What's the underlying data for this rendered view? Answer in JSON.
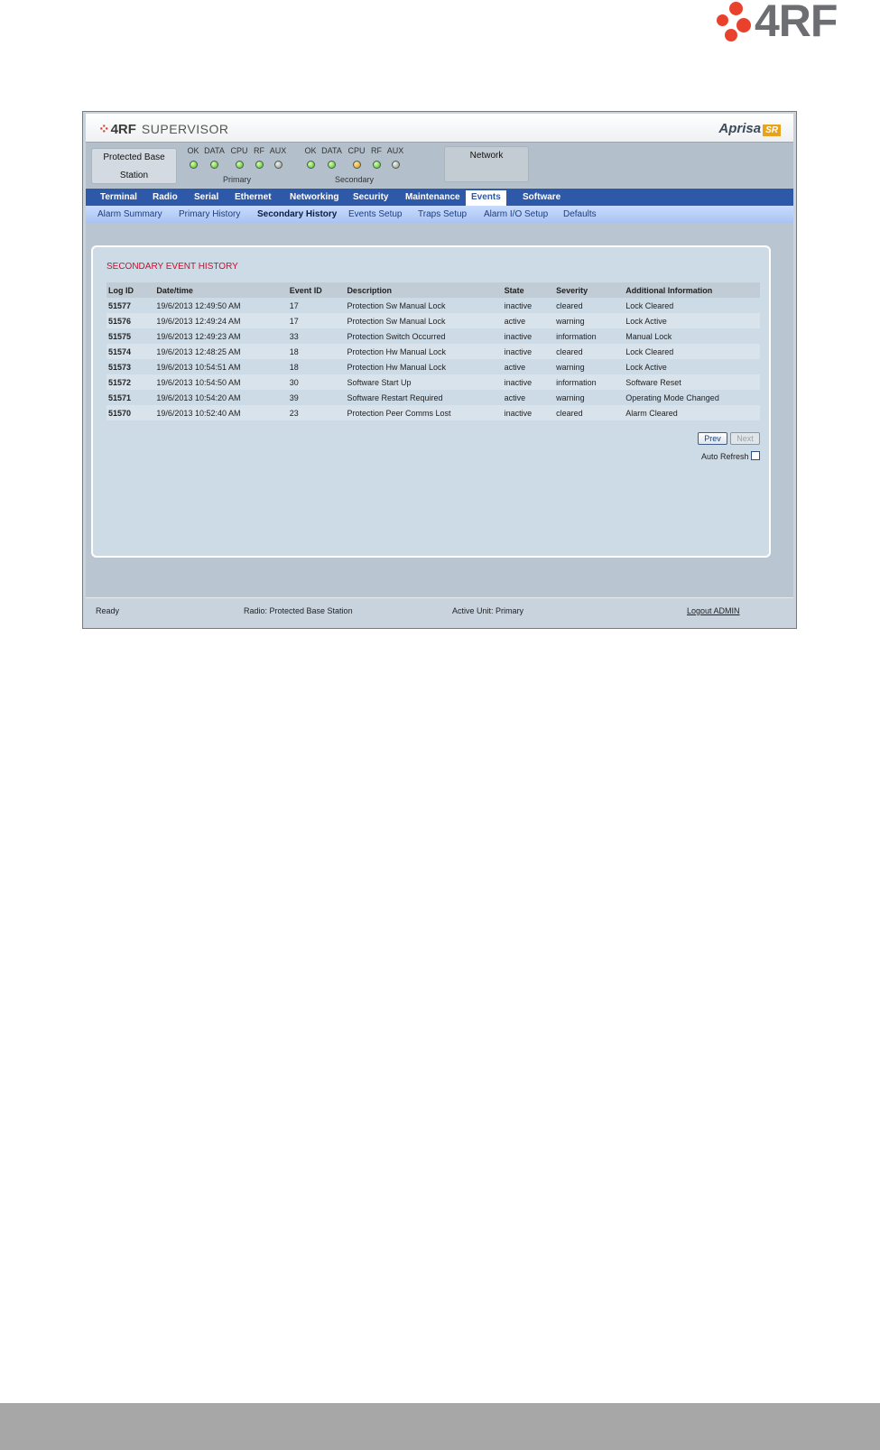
{
  "brand": {
    "corner_logo_text": "4RF"
  },
  "app": {
    "logo_text": "4RF",
    "logo_suffix": "SUPERVISOR",
    "product_logo": "Aprisa",
    "product_badge": "SR"
  },
  "status": {
    "station_line1": "Protected Base",
    "station_line2": "Station",
    "primary": {
      "caption": "Primary",
      "labels": [
        "OK",
        "DATA",
        "CPU",
        "RF",
        "AUX"
      ],
      "leds": [
        "green",
        "green",
        "green",
        "green",
        "grey"
      ]
    },
    "secondary": {
      "caption": "Secondary",
      "labels": [
        "OK",
        "DATA",
        "CPU",
        "RF",
        "AUX"
      ],
      "leds": [
        "green",
        "green",
        "orange",
        "green",
        "grey"
      ]
    },
    "network_label": "Network"
  },
  "nav": {
    "items": [
      "Terminal",
      "Radio",
      "Serial",
      "Ethernet",
      "Networking",
      "Security",
      "Maintenance",
      "Events",
      "Software"
    ],
    "active": "Events"
  },
  "subnav": {
    "items": [
      "Alarm Summary",
      "Primary History",
      "Secondary History",
      "Events Setup",
      "Traps Setup",
      "Alarm I/O Setup",
      "Defaults"
    ],
    "active": "Secondary History"
  },
  "panel": {
    "title": "SECONDARY EVENT HISTORY",
    "columns": [
      "Log ID",
      "Date/time",
      "Event ID",
      "Description",
      "State",
      "Severity",
      "Additional Information"
    ],
    "rows": [
      [
        "51577",
        "19/6/2013 12:49:50 AM",
        "17",
        "Protection Sw Manual Lock",
        "inactive",
        "cleared",
        "Lock Cleared"
      ],
      [
        "51576",
        "19/6/2013 12:49:24 AM",
        "17",
        "Protection Sw Manual Lock",
        "active",
        "warning",
        "Lock Active"
      ],
      [
        "51575",
        "19/6/2013 12:49:23 AM",
        "33",
        "Protection Switch Occurred",
        "inactive",
        "information",
        "Manual Lock"
      ],
      [
        "51574",
        "19/6/2013 12:48:25 AM",
        "18",
        "Protection Hw Manual Lock",
        "inactive",
        "cleared",
        "Lock Cleared"
      ],
      [
        "51573",
        "19/6/2013 10:54:51 AM",
        "18",
        "Protection Hw Manual Lock",
        "active",
        "warning",
        "Lock Active"
      ],
      [
        "51572",
        "19/6/2013 10:54:50 AM",
        "30",
        "Software Start Up",
        "inactive",
        "information",
        "Software Reset"
      ],
      [
        "51571",
        "19/6/2013 10:54:20 AM",
        "39",
        "Software Restart Required",
        "active",
        "warning",
        "Operating Mode Changed"
      ],
      [
        "51570",
        "19/6/2013 10:52:40 AM",
        "23",
        "Protection Peer Comms Lost",
        "inactive",
        "cleared",
        "Alarm Cleared"
      ]
    ],
    "prev_label": "Prev",
    "next_label": "Next",
    "auto_refresh_label": "Auto Refresh",
    "auto_refresh_checked": false
  },
  "footer": {
    "ready": "Ready",
    "radio": "Radio: Protected Base Station",
    "active_unit": "Active Unit: Primary",
    "logout": "Logout ADMIN"
  },
  "colors": {
    "nav_bg": "#2e59a8",
    "title_red": "#c8102e",
    "brand_red": "#e8412c"
  }
}
